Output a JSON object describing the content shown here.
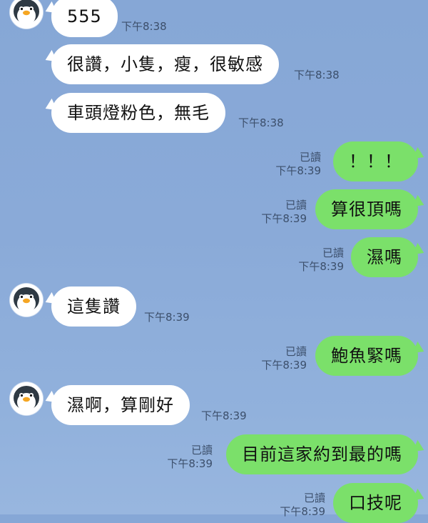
{
  "accent": {
    "incoming_bubble": "#ffffff",
    "outgoing_bubble": "#7be06a",
    "background": "#8aaad8"
  },
  "avatar_icon": "penguin-icon",
  "messages": [
    {
      "dir": "in",
      "text": "555",
      "time": "下午8:38"
    },
    {
      "dir": "in",
      "text": "很讚，小隻，瘦，很敏感",
      "time": "下午8:38"
    },
    {
      "dir": "in",
      "text": "車頭燈粉色，無毛",
      "time": "下午8:38"
    },
    {
      "dir": "out",
      "text": "！！！",
      "read": "已讀",
      "time": "下午8:39"
    },
    {
      "dir": "out",
      "text": "算很頂嗎",
      "read": "已讀",
      "time": "下午8:39"
    },
    {
      "dir": "out",
      "text": "濕嗎",
      "read": "已讀",
      "time": "下午8:39"
    },
    {
      "dir": "in",
      "text": "這隻讚",
      "time": "下午8:39"
    },
    {
      "dir": "out",
      "text": "鮑魚緊嗎",
      "read": "已讀",
      "time": "下午8:39"
    },
    {
      "dir": "in",
      "text": "濕啊，算剛好",
      "time": "下午8:39"
    },
    {
      "dir": "out",
      "text": "目前這家約到最的嗎",
      "read": "已讀",
      "time": "下午8:39"
    },
    {
      "dir": "out",
      "text": "口技呢",
      "read": "已讀",
      "time": "下午8:39"
    }
  ]
}
